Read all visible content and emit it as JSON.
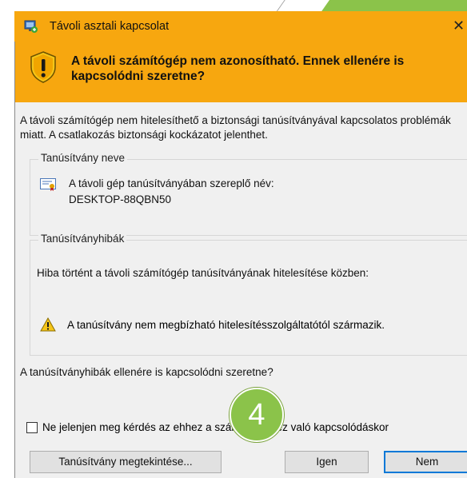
{
  "window": {
    "title": "Távoli asztali kapcsolat",
    "close_glyph": "✕"
  },
  "banner": {
    "text": "A távoli számítógép nem azonosítható. Ennek ellenére is kapcsolódni szeretne?",
    "color": "#f7a70f",
    "icon": "shield-warning-icon"
  },
  "intro": "A távoli számítógép nem hitelesíthető a biztonsági tanúsítványával kapcsolatos problémák miatt. A csatlakozás biztonsági kockázatot jelenthet.",
  "certificate_group": {
    "legend": "Tanúsítvány neve",
    "label": "A távoli gép tanúsítványában szereplő név:",
    "name": "DESKTOP-88QBN50",
    "icon": "certificate-icon"
  },
  "errors_group": {
    "legend": "Tanúsítványhibák",
    "description": "Hiba történt a távoli számítógép tanúsítványának hitelesítése közben:",
    "warning": "A tanúsítvány nem megbízható hitelesítésszolgáltatótól származik.",
    "icon": "warning-icon"
  },
  "question": "A tanúsítványhibák ellenére is kapcsolódni szeretne?",
  "checkbox": {
    "label": "Ne jelenjen meg kérdés az ehhez a számítógéphez való kapcsolódáskor",
    "checked": false
  },
  "buttons": {
    "view_certificate": "Tanúsítvány megtekintése...",
    "yes": "Igen",
    "no": "Nem"
  },
  "step_badge": {
    "number": "4",
    "color": "#8bc34a"
  }
}
